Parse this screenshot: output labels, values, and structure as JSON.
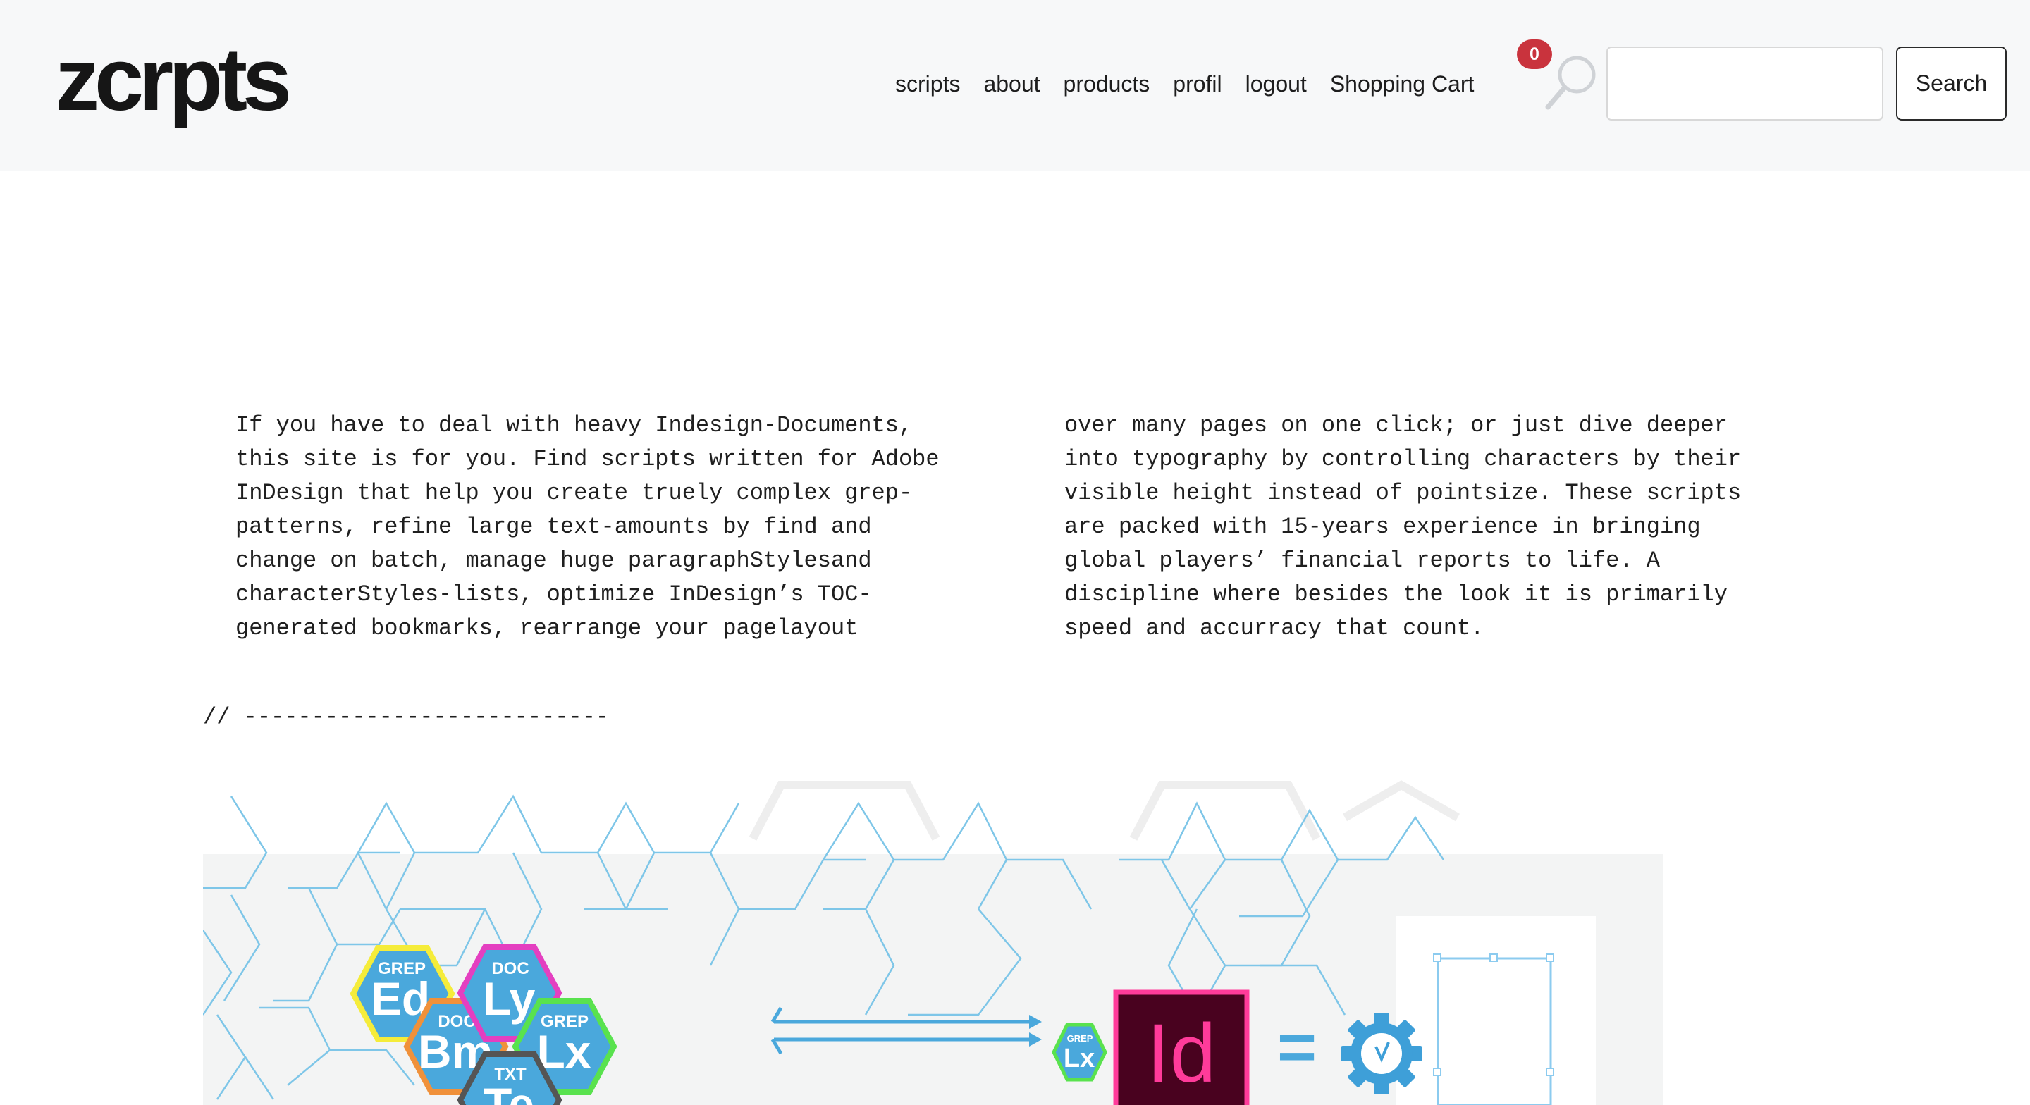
{
  "header": {
    "logo": "zcrpts",
    "nav": [
      {
        "label": "scripts"
      },
      {
        "label": "about"
      },
      {
        "label": "products"
      },
      {
        "label": "profil"
      },
      {
        "label": "logout"
      },
      {
        "label": "Shopping Cart"
      }
    ],
    "cart_count": "0",
    "search": {
      "value": "",
      "placeholder": "",
      "button_label": "Search"
    }
  },
  "intro": {
    "left_lines": [
      "If you have to deal with heavy Indesign-Documents,",
      "this site is for you. Find scripts written for Adobe",
      "InDesign that help you create truely complex grep-",
      "patterns, refine large text-amounts by find and",
      "change on batch, manage huge paragraphStylesand",
      "characterStyles-lists, optimize InDesign’s TOC-",
      "generated bookmarks, rearrange your pagelayout"
    ],
    "right_lines": [
      "over many pages on one click; or just dive deeper",
      "into typography by controlling characters by their",
      "visible height instead of pointsize. These scripts",
      "are packed with 15-years experience in bringing",
      "global players’ financial reports to life. A",
      "discipline where besides the look it is primarily",
      "speed and accurracy that count."
    ]
  },
  "separator": "// ---------------------------",
  "banner": {
    "hexes": [
      {
        "small": "GREP",
        "big": "Ed",
        "border": "#f5ec3a"
      },
      {
        "small": "DOC",
        "big": "Bm",
        "border": "#f0913a"
      },
      {
        "small": "DOC",
        "big": "Ly",
        "border": "#e43fc0"
      },
      {
        "small": "GREP",
        "big": "Lx",
        "border": "#59e24e"
      },
      {
        "small": "TXT",
        "big": "Te",
        "border": "#555555"
      }
    ],
    "mini_hex": {
      "small": "GREP",
      "big": "Lx"
    },
    "app_icon": "Id",
    "equals": "=",
    "colors": {
      "hex_fill": "#4aa8dc",
      "indesign_bg": "#49021f",
      "indesign_accent": "#ff3b9a",
      "gear": "#3e9fd8",
      "pattern": "#7ec6e8"
    }
  }
}
